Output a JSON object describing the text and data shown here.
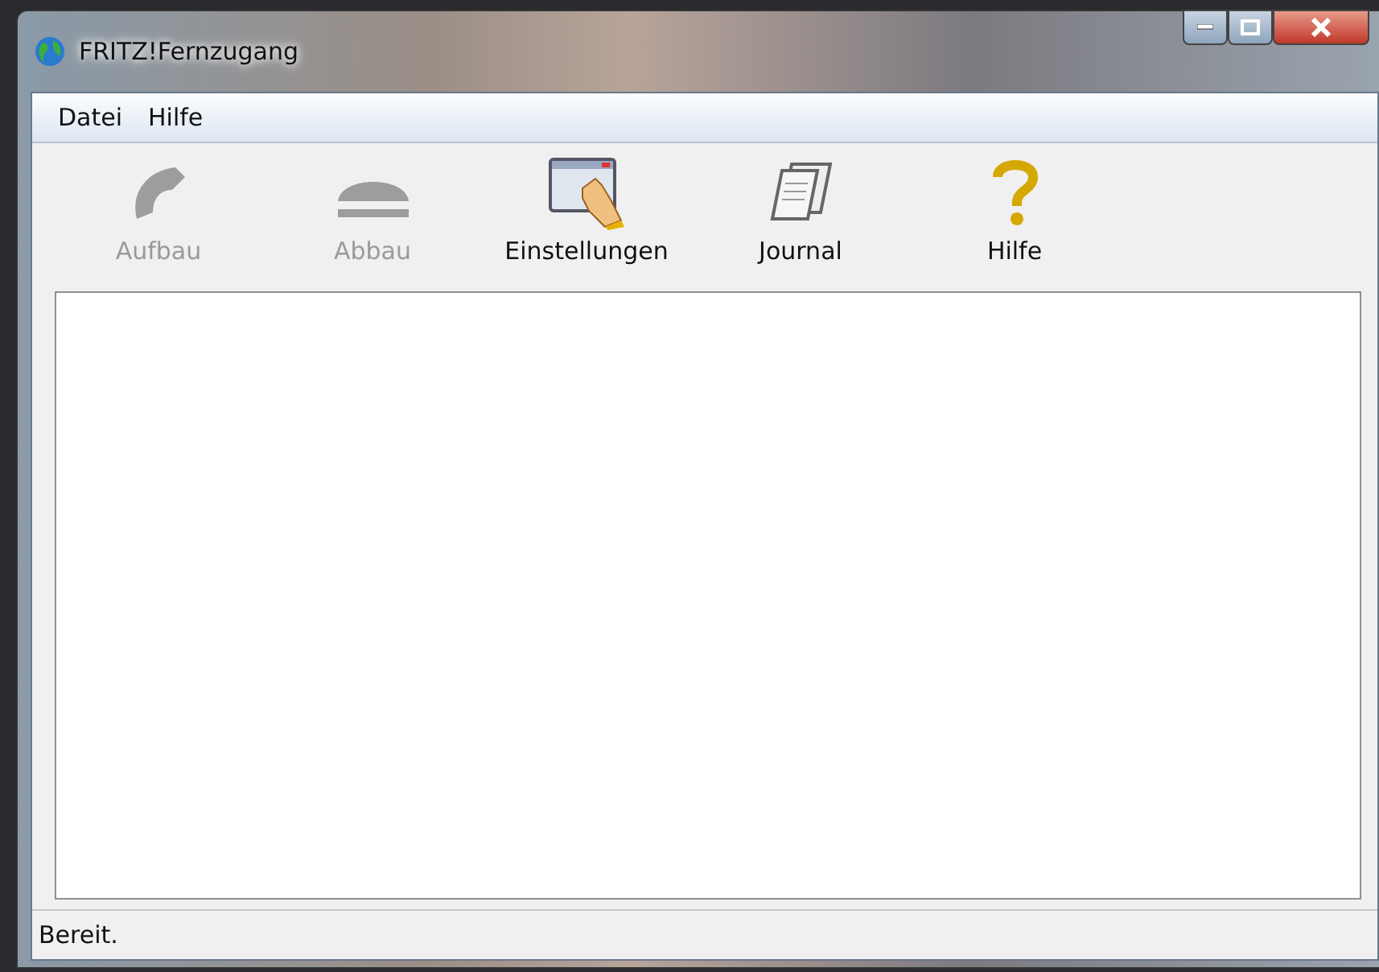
{
  "window": {
    "title": "FRITZ!Fernzugang"
  },
  "menu": [
    {
      "label": "Datei"
    },
    {
      "label": "Hilfe"
    }
  ],
  "toolbar": [
    {
      "kind": "dial",
      "label": "Aufbau",
      "disabled": true
    },
    {
      "kind": "hangup",
      "label": "Abbau",
      "disabled": true
    },
    {
      "kind": "settings",
      "label": "Einstellungen",
      "disabled": false
    },
    {
      "kind": "journal",
      "label": "Journal",
      "disabled": false
    },
    {
      "kind": "help",
      "label": "Hilfe",
      "disabled": false
    }
  ],
  "status_bar": {
    "text": "Bereit."
  }
}
